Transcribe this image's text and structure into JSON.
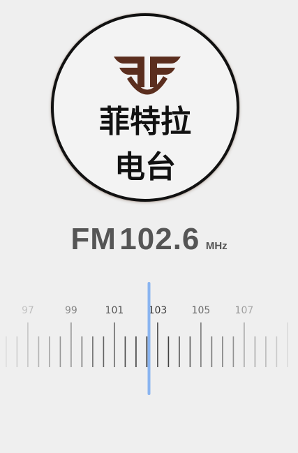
{
  "station": {
    "logo_icon": "wings-ff-emblem-icon",
    "name_line1": "菲特拉",
    "name_line2": "电台"
  },
  "frequency": {
    "band": "FM",
    "value": "102.6",
    "unit": "MHz"
  },
  "tuner": {
    "scale_labels": [
      "97",
      "99",
      "101",
      "103",
      "105",
      "107"
    ],
    "current_value": 102.6,
    "colors": {
      "indicator": "#8ab4f0",
      "emblem": "#5b2e1e"
    }
  }
}
